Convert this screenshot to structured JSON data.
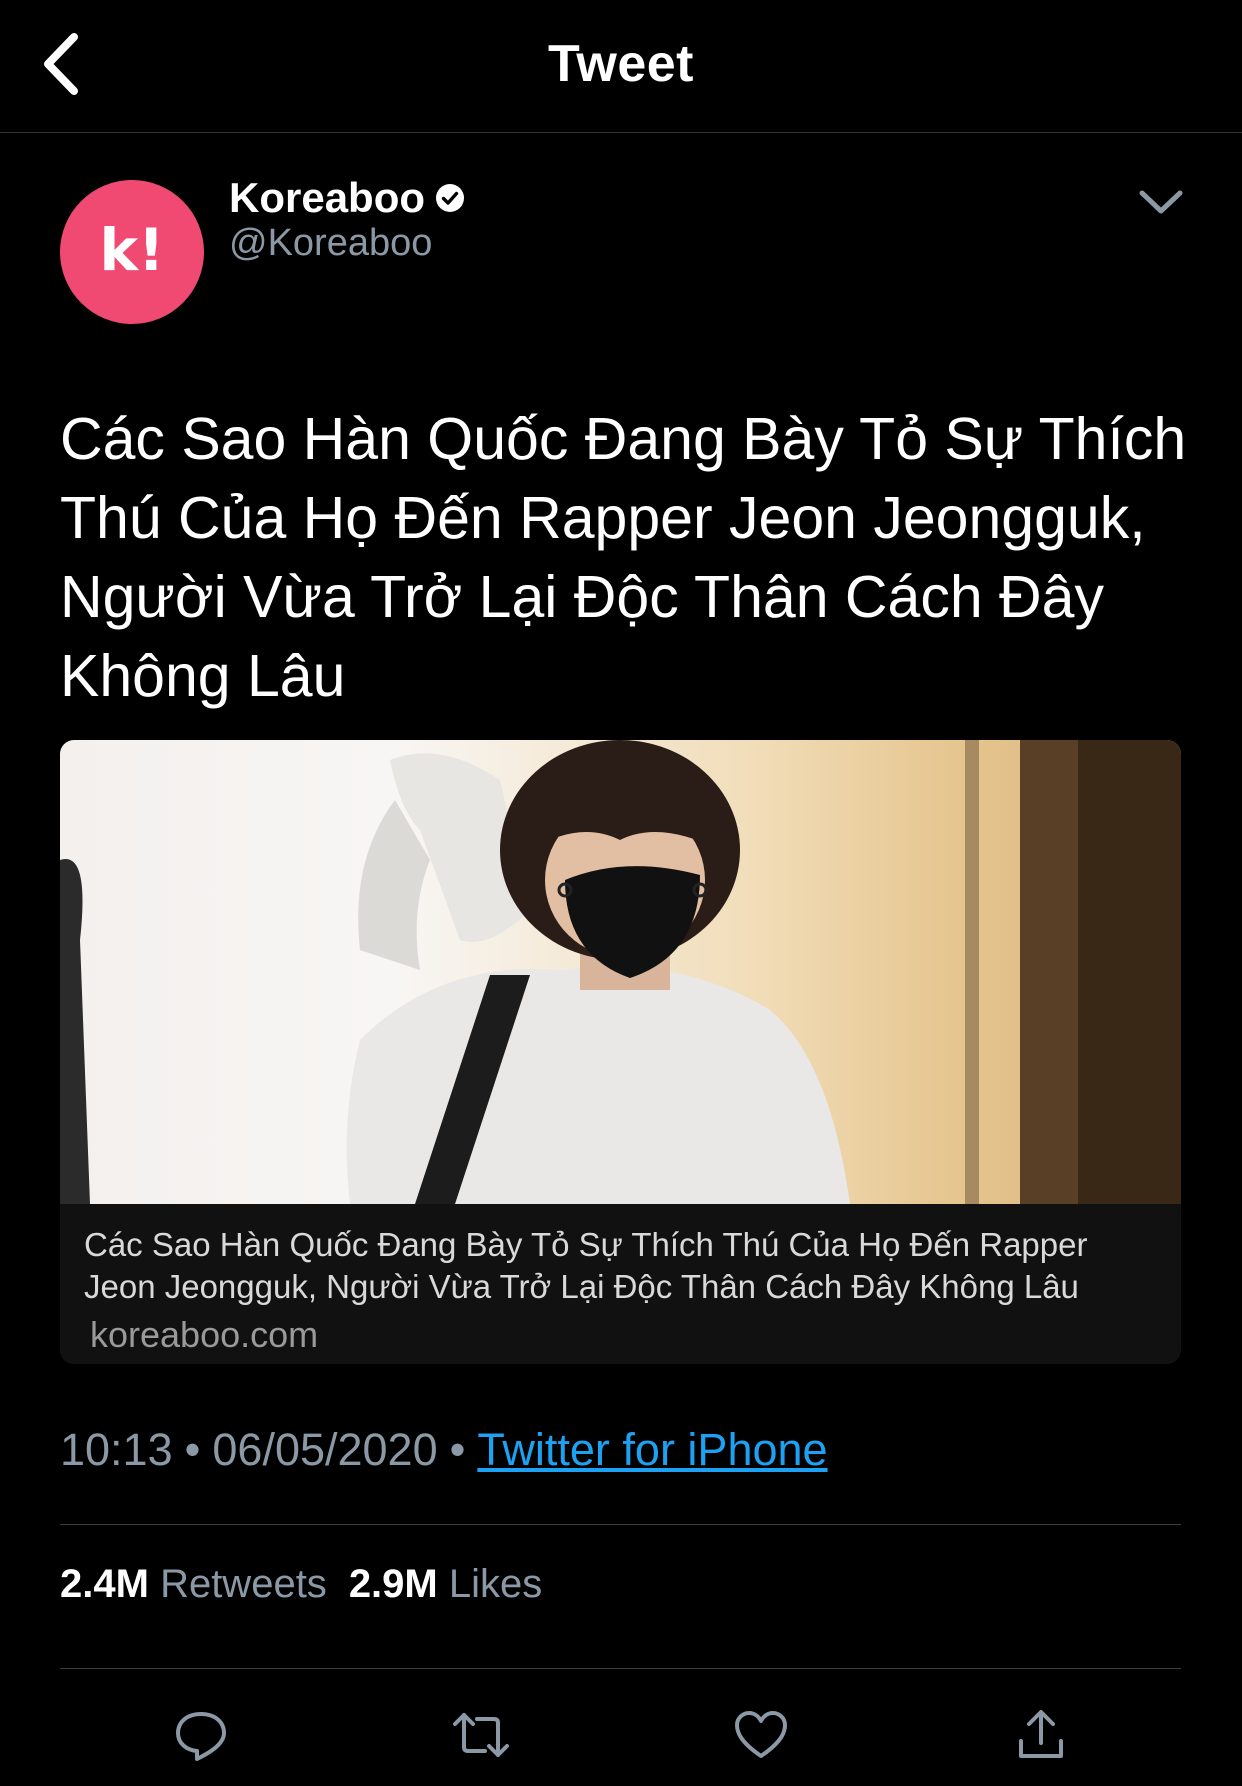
{
  "header": {
    "title": "Tweet",
    "back_icon": "chevron-left-icon"
  },
  "author": {
    "display_name": "Koreaboo",
    "handle": "@Koreaboo",
    "verified": true,
    "avatar_letter": "k!",
    "avatar_color": "#f04a73"
  },
  "tweet": {
    "text": "Các Sao Hàn Quốc Đang Bày Tỏ Sự Thích Thú Của Họ Đến Rapper Jeon Jeongguk, Người Vừa Trở Lại Độc Thân Cách Đây Không Lâu"
  },
  "card": {
    "title": "Các Sao Hàn Quốc Đang Bày Tỏ Sự Thích Thú Của Họ Đến Rapper Jeon Jeongguk, Người Vừa Trở Lại Độc Thân Cách Đây Không Lâu",
    "domain": "koreaboo.com"
  },
  "meta": {
    "time": "10:13",
    "separator": "•",
    "date": "06/05/2020",
    "source": "Twitter for iPhone"
  },
  "stats": {
    "retweets_count": "2.4M",
    "retweets_label": "Retweets",
    "likes_count": "2.9M",
    "likes_label": "Likes"
  },
  "actions": {
    "reply_icon": "reply-icon",
    "retweet_icon": "retweet-icon",
    "like_icon": "heart-icon",
    "share_icon": "share-icon"
  },
  "colors": {
    "background": "#000000",
    "link": "#1da1f2",
    "secondary_text": "#8b98a5",
    "divider": "#3a3f44"
  }
}
